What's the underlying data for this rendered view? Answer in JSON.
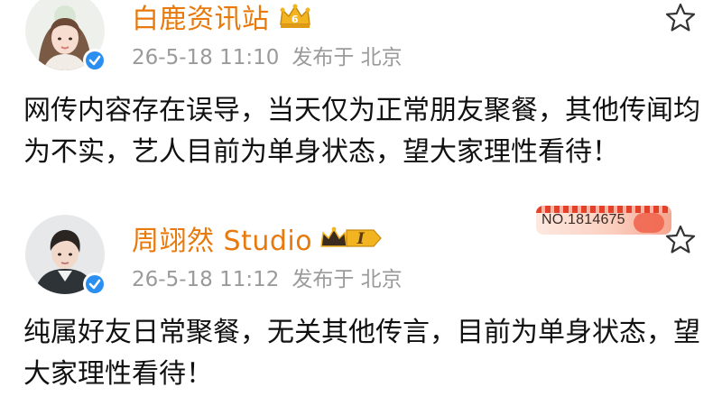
{
  "posts": [
    {
      "author": "白鹿资讯站",
      "timestamp": "26-5-18 11:10",
      "location": "发布于 北京",
      "content": "网传内容存在误导，当天仅为正常朋友聚餐，其他传闻均为不实，艺人目前为单身状态，望大家理性看待！",
      "avatar_icon": "avatar-woman",
      "verified_icon": "verified-icon",
      "crown_icon": "crown-badge-icon",
      "star_icon": "star-outline-icon"
    },
    {
      "author": "周翊然 Studio",
      "timestamp": "26-5-18 11:12",
      "location": "发布于 北京",
      "content": "纯属好友日常聚餐，无关其他传言，目前为单身状态，望大家理性看待！",
      "avatar_icon": "avatar-man",
      "verified_icon": "verified-icon",
      "crown_icon": "crown-level-badge-icon",
      "crown_level": "I",
      "star_icon": "star-outline-icon"
    }
  ],
  "fan_badge": {
    "number": "NO.1814675"
  },
  "colors": {
    "author": "#e8790c",
    "meta": "#9a9a9a",
    "verified": "#2a8ff0",
    "text": "#111111"
  }
}
